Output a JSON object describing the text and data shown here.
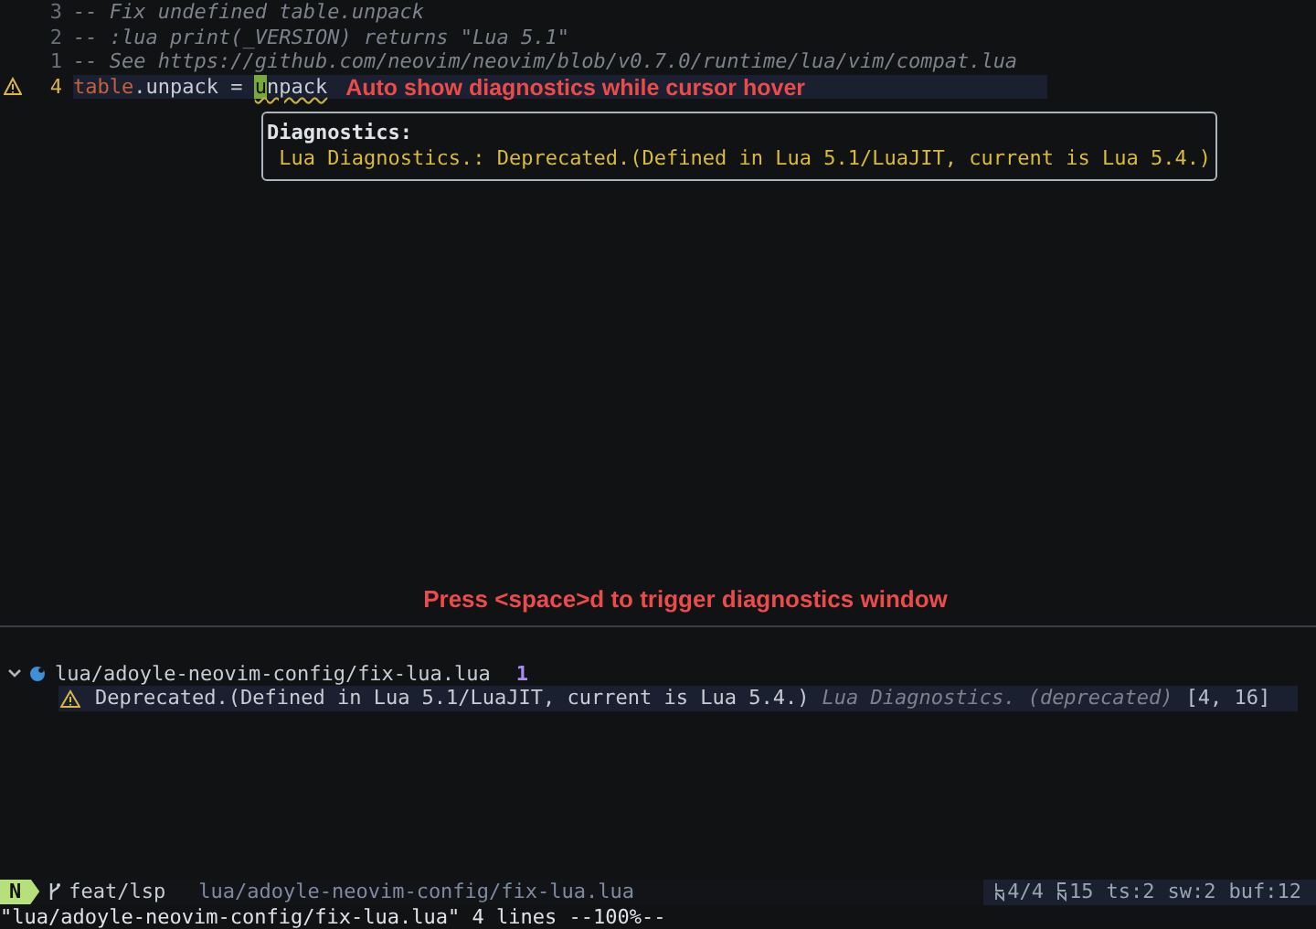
{
  "editor": {
    "lines": [
      {
        "number": "3",
        "kind": "comment",
        "warning": false,
        "current": false,
        "text": "-- Fix undefined table.unpack"
      },
      {
        "number": "2",
        "kind": "comment",
        "warning": false,
        "current": false,
        "text": "-- :lua print(_VERSION) returns \"Lua 5.1\""
      },
      {
        "number": "1",
        "kind": "comment",
        "warning": false,
        "current": false,
        "text": "-- See https://github.com/neovim/neovim/blob/v0.7.0/runtime/lua/vim/compat.lua"
      },
      {
        "number": "4",
        "kind": "code",
        "warning": true,
        "current": true,
        "object": "table",
        "rest": ".unpack = ",
        "cursor": "u",
        "after_cursor": "npack",
        "annotation": "Auto show diagnostics while cursor hover"
      }
    ]
  },
  "popup": {
    "title": "Diagnostics:",
    "message": "Lua Diagnostics.: Deprecated.(Defined in Lua 5.1/LuaJIT, current is Lua 5.4.)"
  },
  "hint": "Press <space>d to trigger diagnostics window",
  "quickfix": {
    "files": [
      {
        "path": "lua/adoyle-neovim-config/fix-lua.lua",
        "count": "1",
        "expanded": true,
        "items": [
          {
            "message": "Deprecated.(Defined in Lua 5.1/LuaJIT, current is Lua 5.4.)",
            "source": "Lua Diagnostics. (deprecated)",
            "position": "[4, 16]",
            "selected": true
          }
        ]
      }
    ]
  },
  "status_bar": {
    "mode": "N",
    "branch": "feat/lsp",
    "file": "lua/adoyle-neovim-config/fix-lua.lua",
    "line": "4/4",
    "column": "15",
    "ts": "ts:2",
    "sw": "sw:2",
    "buf": "buf:12"
  },
  "command_line": "\"lua/adoyle-neovim-config/fix-lua.lua\" 4 lines --100%--"
}
